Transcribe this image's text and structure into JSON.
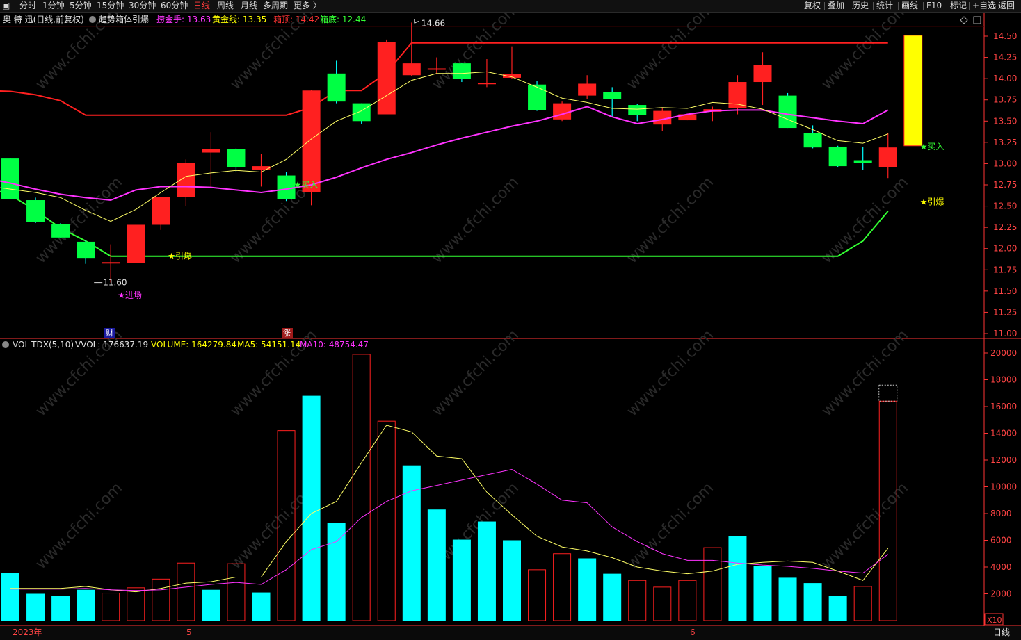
{
  "toolbar": {
    "left_items": [
      {
        "id": "fenshi",
        "label": "分时"
      },
      {
        "id": "1min",
        "label": "1分钟"
      },
      {
        "id": "5min",
        "label": "5分钟"
      },
      {
        "id": "15min",
        "label": "15分钟"
      },
      {
        "id": "30min",
        "label": "30分钟"
      },
      {
        "id": "60min",
        "label": "60分钟"
      },
      {
        "id": "day",
        "label": "日线",
        "active": true
      },
      {
        "id": "week",
        "label": "周线"
      },
      {
        "id": "month",
        "label": "月线"
      },
      {
        "id": "multi",
        "label": "多周期"
      },
      {
        "id": "more",
        "label": "更多 〉"
      }
    ],
    "right_items": [
      {
        "id": "fuquan",
        "label": "复权"
      },
      {
        "id": "diejia",
        "label": "叠加"
      },
      {
        "id": "lishi",
        "label": "历史"
      },
      {
        "id": "tongji",
        "label": "统计"
      },
      {
        "id": "huaxian",
        "label": "画线"
      },
      {
        "id": "f10",
        "label": "F10"
      },
      {
        "id": "biaoji",
        "label": "标记"
      },
      {
        "id": "zixuan",
        "label": "+自选"
      },
      {
        "id": "fanhui",
        "label": "返回"
      }
    ]
  },
  "price_header": {
    "stock": "奥 特 迅(日线,前复权)",
    "indicator": "趋势箱体引爆",
    "items": [
      {
        "label": "捞金手: 13.63",
        "color": "#ff33ff"
      },
      {
        "label": "黄金线: 13.35",
        "color": "#ffff00"
      },
      {
        "label": "箱顶: 14.42",
        "color": "#ff3333"
      },
      {
        "label": "箱底: 12.44",
        "color": "#33ff33"
      }
    ]
  },
  "volume_header": {
    "name": "VOL-TDX(5,10)",
    "items": [
      {
        "label": "VVOL: 176637.19",
        "color": "#e0e0e0"
      },
      {
        "label": "VOLUME: 164279.84",
        "color": "#ffff00"
      },
      {
        "label": "MA5: 54151.14",
        "color": "#ffff00"
      },
      {
        "label": "MA10: 48754.47",
        "color": "#ff33ff"
      }
    ]
  },
  "annotations": {
    "high_label": "14.66",
    "low_label": "11.60",
    "entry": "★进场",
    "ignite": "★引爆",
    "buy": "★买入",
    "cai_marker": "财",
    "zhang_marker": "涨",
    "vol_multiplier": "X10",
    "period_label": "日线",
    "watermark": "www.cfchi.com"
  },
  "colors": {
    "up": "#ff2020",
    "down_candle": "#00ff44",
    "down_volume": "#00ffff",
    "box_top": "#ff2020",
    "box_bottom": "#33ff33",
    "laojin": "#ff33ff",
    "gold": "#ffff66",
    "axis": "#ff3333",
    "highlight": "#ffff00"
  },
  "chart_data": [
    {
      "type": "candlestick",
      "title": "奥 特 迅(日线,前复权)",
      "ylim": [
        11.0,
        14.5
      ],
      "y_ticks": [
        11.0,
        11.25,
        11.5,
        11.75,
        12.0,
        12.25,
        12.5,
        12.75,
        13.0,
        13.25,
        13.5,
        13.75,
        14.0,
        14.25,
        14.5
      ],
      "x_axis_labels": [
        {
          "index": 0,
          "label": "2023年"
        },
        {
          "index": 7,
          "label": "5"
        },
        {
          "index": 27,
          "label": "6"
        }
      ],
      "candles": [
        {
          "o": 13.06,
          "h": 13.06,
          "l": 12.58,
          "c": 12.58
        },
        {
          "o": 12.57,
          "h": 12.6,
          "l": 12.3,
          "c": 12.31
        },
        {
          "o": 12.29,
          "h": 12.3,
          "l": 12.13,
          "c": 12.13
        },
        {
          "o": 12.08,
          "h": 12.1,
          "l": 11.82,
          "c": 11.89
        },
        {
          "o": 11.83,
          "h": 12.05,
          "l": 11.6,
          "c": 11.84
        },
        {
          "o": 11.83,
          "h": 12.28,
          "l": 11.83,
          "c": 12.28
        },
        {
          "o": 12.28,
          "h": 12.6,
          "l": 12.22,
          "c": 12.61
        },
        {
          "o": 12.61,
          "h": 13.05,
          "l": 12.5,
          "c": 13.01
        },
        {
          "o": 13.13,
          "h": 13.37,
          "l": 12.73,
          "c": 13.17
        },
        {
          "o": 13.17,
          "h": 13.18,
          "l": 12.9,
          "c": 12.96
        },
        {
          "o": 12.93,
          "h": 13.11,
          "l": 12.73,
          "c": 12.97
        },
        {
          "o": 12.86,
          "h": 12.9,
          "l": 12.56,
          "c": 12.58
        },
        {
          "o": 12.66,
          "h": 13.87,
          "l": 12.51,
          "c": 13.86
        },
        {
          "o": 14.06,
          "h": 14.21,
          "l": 13.71,
          "c": 13.73
        },
        {
          "o": 13.71,
          "h": 13.71,
          "l": 13.47,
          "c": 13.5
        },
        {
          "o": 13.58,
          "h": 14.46,
          "l": 13.58,
          "c": 14.43
        },
        {
          "o": 14.04,
          "h": 14.66,
          "l": 14.03,
          "c": 14.18
        },
        {
          "o": 14.12,
          "h": 14.25,
          "l": 14.05,
          "c": 14.12
        },
        {
          "o": 14.18,
          "h": 14.19,
          "l": 13.96,
          "c": 14.0
        },
        {
          "o": 13.95,
          "h": 14.23,
          "l": 13.9,
          "c": 13.95
        },
        {
          "o": 14.01,
          "h": 14.38,
          "l": 14.0,
          "c": 14.05
        },
        {
          "o": 13.93,
          "h": 13.97,
          "l": 13.62,
          "c": 13.63
        },
        {
          "o": 13.52,
          "h": 13.73,
          "l": 13.5,
          "c": 13.71
        },
        {
          "o": 13.8,
          "h": 14.04,
          "l": 13.76,
          "c": 13.94
        },
        {
          "o": 13.84,
          "h": 13.9,
          "l": 13.55,
          "c": 13.76
        },
        {
          "o": 13.69,
          "h": 13.7,
          "l": 13.5,
          "c": 13.57
        },
        {
          "o": 13.46,
          "h": 13.65,
          "l": 13.38,
          "c": 13.62
        },
        {
          "o": 13.51,
          "h": 13.57,
          "l": 13.51,
          "c": 13.58
        },
        {
          "o": 13.61,
          "h": 13.67,
          "l": 13.5,
          "c": 13.64
        },
        {
          "o": 13.65,
          "h": 14.04,
          "l": 13.58,
          "c": 13.96
        },
        {
          "o": 13.96,
          "h": 14.31,
          "l": 13.69,
          "c": 14.16
        },
        {
          "o": 13.8,
          "h": 13.83,
          "l": 13.42,
          "c": 13.42
        },
        {
          "o": 13.36,
          "h": 13.45,
          "l": 13.18,
          "c": 13.19
        },
        {
          "o": 13.2,
          "h": 13.21,
          "l": 12.96,
          "c": 12.97
        },
        {
          "o": 13.04,
          "h": 13.2,
          "l": 12.93,
          "c": 13.01
        },
        {
          "o": 12.96,
          "h": 13.36,
          "l": 12.83,
          "c": 13.19
        },
        {
          "o": 13.21,
          "h": 14.51,
          "l": 13.21,
          "c": 14.51,
          "highlight": true
        }
      ],
      "series": [
        {
          "name": "箱顶",
          "values": [
            13.86,
            13.85,
            13.81,
            13.74,
            13.57,
            13.57,
            13.57,
            13.57,
            13.57,
            13.57,
            13.57,
            13.57,
            13.57,
            13.66,
            13.86,
            13.86,
            14.07,
            14.42,
            14.42,
            14.42,
            14.42,
            14.42,
            14.42,
            14.42,
            14.42,
            14.42,
            14.42,
            14.42,
            14.42,
            14.42,
            14.42,
            14.42,
            14.42,
            14.42,
            14.42,
            14.42,
            14.42
          ]
        },
        {
          "name": "箱底",
          "values": [
            12.73,
            12.63,
            12.45,
            12.24,
            12.09,
            11.91,
            11.91,
            11.91,
            11.91,
            11.91,
            11.91,
            11.91,
            11.91,
            11.91,
            11.91,
            11.91,
            11.91,
            11.91,
            11.91,
            11.91,
            11.91,
            11.91,
            11.91,
            11.91,
            11.91,
            11.91,
            11.91,
            11.91,
            11.91,
            11.91,
            11.91,
            11.91,
            11.91,
            11.91,
            11.91,
            12.09,
            12.44
          ]
        },
        {
          "name": "捞金手",
          "values": [
            12.83,
            12.77,
            12.7,
            12.64,
            12.6,
            12.57,
            12.69,
            12.73,
            12.73,
            12.72,
            12.69,
            12.66,
            12.7,
            12.75,
            12.84,
            12.95,
            13.05,
            13.13,
            13.22,
            13.3,
            13.37,
            13.44,
            13.5,
            13.58,
            13.67,
            13.55,
            13.47,
            13.52,
            13.58,
            13.62,
            13.63,
            13.63,
            13.58,
            13.54,
            13.5,
            13.47,
            13.63
          ]
        },
        {
          "name": "黄金线",
          "values": [
            12.74,
            12.7,
            12.66,
            12.6,
            12.45,
            12.32,
            12.46,
            12.66,
            12.85,
            12.89,
            12.92,
            12.9,
            13.05,
            13.29,
            13.5,
            13.62,
            13.8,
            13.98,
            14.06,
            14.06,
            14.08,
            14.02,
            13.9,
            13.77,
            13.72,
            13.65,
            13.64,
            13.66,
            13.65,
            13.72,
            13.7,
            13.64,
            13.52,
            13.4,
            13.27,
            13.24,
            13.35
          ]
        }
      ]
    },
    {
      "type": "bar",
      "title": "VOL-TDX(5,10)",
      "ylim": [
        0,
        20000
      ],
      "y_ticks": [
        2000,
        4000,
        6000,
        8000,
        10000,
        12000,
        14000,
        16000,
        18000,
        20000
      ],
      "values": [
        3550,
        2000,
        1850,
        2300,
        2050,
        2450,
        3100,
        4300,
        2300,
        4250,
        2100,
        14200,
        16800,
        7300,
        19900,
        14900,
        11600,
        8300,
        6050,
        7400,
        6000,
        3800,
        5000,
        4650,
        3500,
        3000,
        2500,
        3000,
        5450,
        6300,
        4100,
        3200,
        2800,
        1850,
        2550,
        16400
      ],
      "up_flags": [
        false,
        false,
        false,
        false,
        true,
        true,
        true,
        true,
        false,
        true,
        false,
        true,
        false,
        false,
        true,
        true,
        false,
        false,
        false,
        false,
        false,
        true,
        true,
        false,
        false,
        true,
        true,
        true,
        true,
        false,
        false,
        false,
        false,
        false,
        true,
        true
      ],
      "highlight_value": 17600,
      "series": [
        {
          "name": "MA5",
          "values": [
            2400,
            2400,
            2400,
            2550,
            2300,
            2150,
            2400,
            2800,
            2900,
            3250,
            3250,
            5900,
            8000,
            8900,
            11800,
            14600,
            14100,
            12300,
            12100,
            9600,
            7900,
            6300,
            5500,
            5200,
            4700,
            4000,
            3700,
            3500,
            3700,
            4200,
            4350,
            4450,
            4350,
            3700,
            3000,
            5400
          ]
        },
        {
          "name": "MA10",
          "values": [
            2350,
            2350,
            2350,
            2400,
            2300,
            2250,
            2300,
            2500,
            2700,
            2850,
            2700,
            3800,
            5300,
            5900,
            7700,
            8900,
            9700,
            10100,
            10500,
            10900,
            11300,
            10200,
            9000,
            8800,
            7000,
            5900,
            5000,
            4500,
            4500,
            4300,
            4150,
            4050,
            3900,
            3700,
            3550,
            4950
          ]
        }
      ]
    }
  ]
}
